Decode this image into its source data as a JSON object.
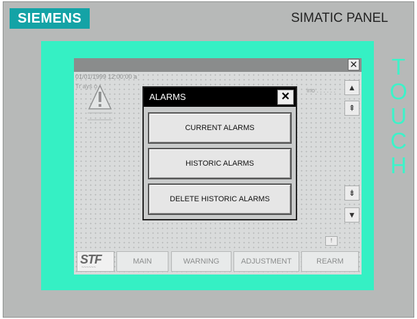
{
  "panel": {
    "brand": "SIEMENS",
    "model": "SIMATIC PANEL",
    "touch_letters": [
      "T",
      "O",
      "U",
      "C",
      "H"
    ]
  },
  "screen": {
    "close_label": "✕",
    "timestamp": "01/01/1999 12:00:00 a",
    "partial_text_left": "Tr         ays o",
    "partial_text_right": "ino . . . . . .",
    "side_buttons": {
      "up": "▲",
      "page_up": "⇞",
      "page_down": "⇟",
      "down": "▼",
      "small": "!"
    }
  },
  "bottom_bar": {
    "logo_text": "STF",
    "logo_subtext": "~~~~~~",
    "buttons": [
      "MAIN",
      "WARNING",
      "ADJUSTMENT",
      "REARM"
    ]
  },
  "dialog": {
    "title": "ALARMS",
    "close_label": "✕",
    "buttons": [
      "CURRENT ALARMS",
      "HISTORIC ALARMS",
      "DELETE HISTORIC ALARMS"
    ]
  },
  "colors": {
    "brand_teal": "#14a3a6",
    "bezel_green": "#35f0c4",
    "dialog_title_bg": "#000000"
  }
}
